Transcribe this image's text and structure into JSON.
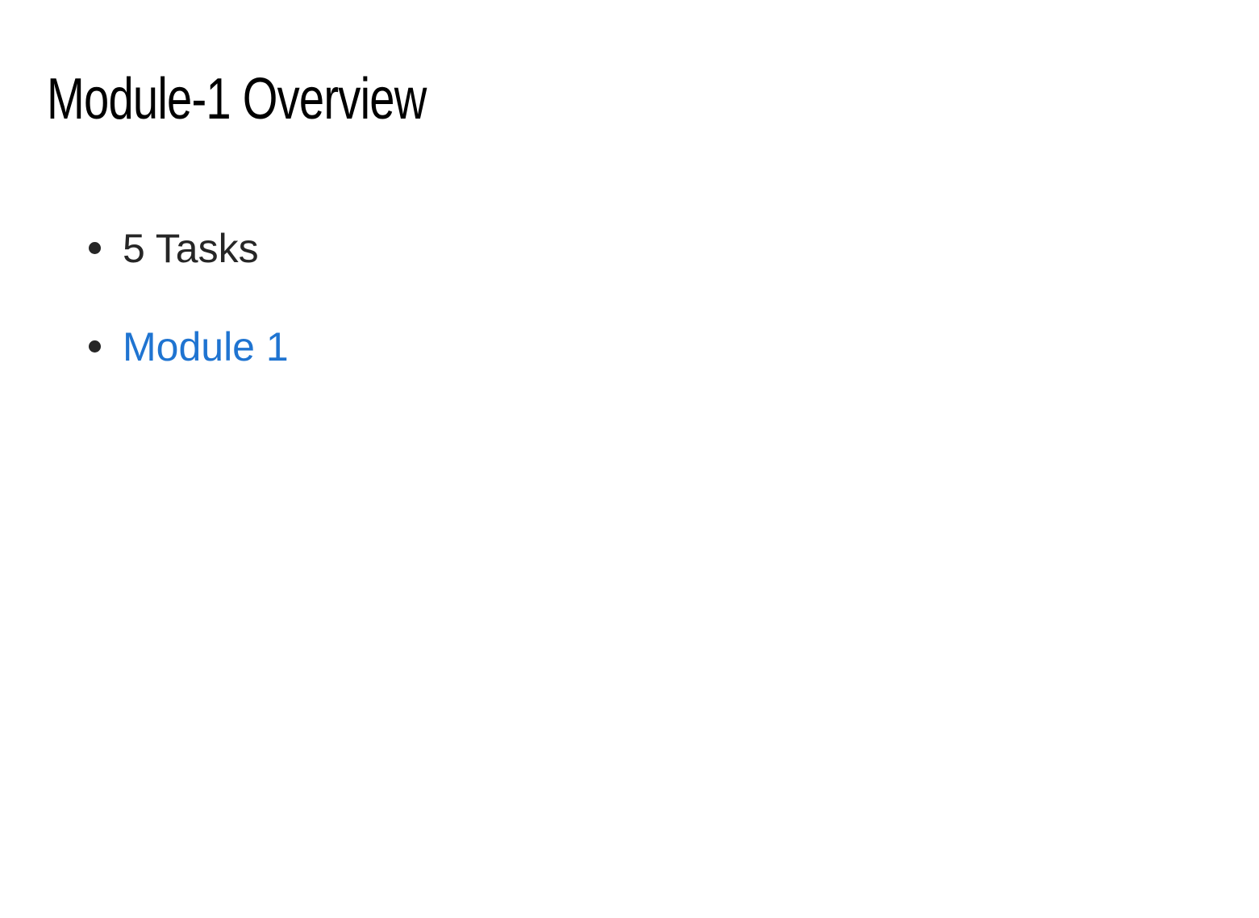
{
  "page": {
    "title": "Module-1 Overview"
  },
  "overview": {
    "items": [
      {
        "text": "5 Tasks"
      },
      {
        "link_text": "Module 1"
      }
    ]
  },
  "colors": {
    "background": "#ffffff",
    "title_text": "#000000",
    "body_text": "#262626",
    "link": "#1f74d1"
  },
  "icons": {
    "bullet": "bullet-dot-icon"
  }
}
